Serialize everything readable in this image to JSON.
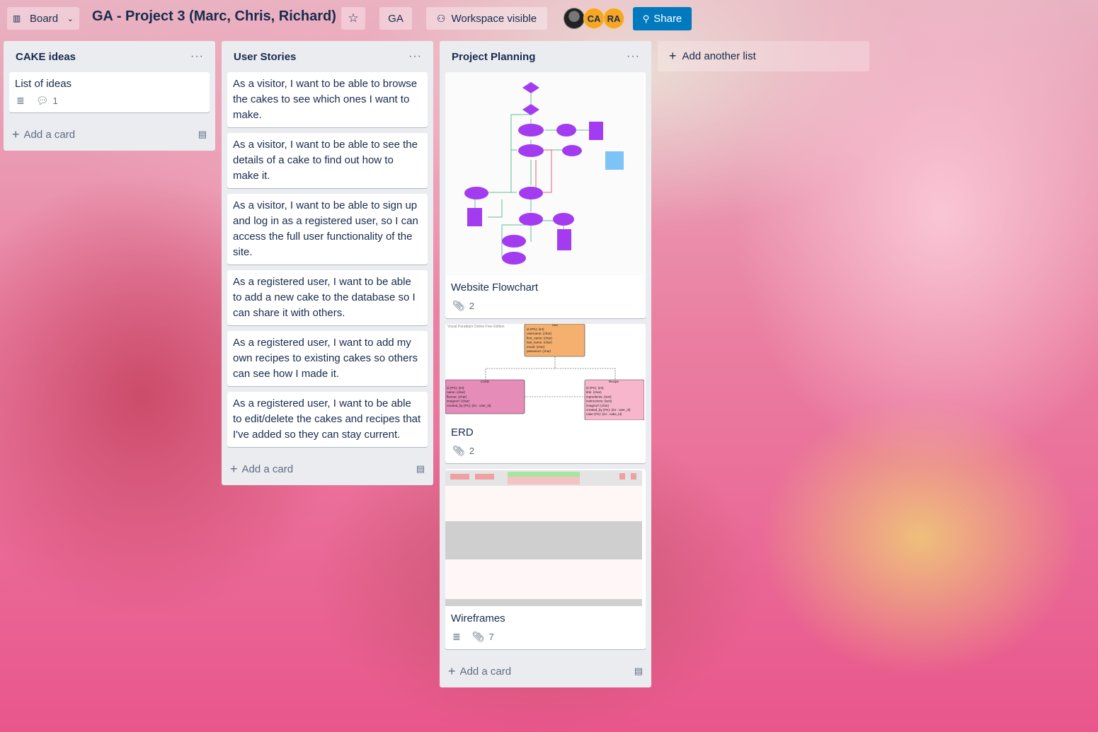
{
  "header": {
    "view_switcher": "Board",
    "board_title": "GA - Project 3 (Marc, Chris, Richard)",
    "team_label": "GA",
    "visibility_label": "Workspace visible",
    "members": [
      "CA",
      "RA"
    ],
    "share_label": "Share"
  },
  "lists": [
    {
      "title": "CAKE ideas",
      "cards": [
        {
          "text": "List of ideas",
          "comments": "1"
        }
      ],
      "add_card": "Add a card"
    },
    {
      "title": "User Stories",
      "cards": [
        {
          "text": "As a visitor, I want to be able to browse the cakes to see which ones I want to make."
        },
        {
          "text": "As a visitor, I want to be able to see the details of a cake to find out how to make it."
        },
        {
          "text": "As a visitor, I want to be able to sign up and log in as a registered user, so I can access the full user functionality of the site."
        },
        {
          "text": "As a registered user, I want to be able to add a new cake to the database so I can share it with others."
        },
        {
          "text": "As a registered user, I want to add my own recipes to existing cakes so others can see how I made it."
        },
        {
          "text": "As a registered user, I want to be able to edit/delete the cakes and recipes that I've added so they can stay current."
        }
      ],
      "add_card": "Add a card"
    },
    {
      "title": "Project Planning",
      "cards": [
        {
          "text": "Website Flowchart",
          "attachments": "2"
        },
        {
          "text": "ERD",
          "attachments": "2",
          "erd": {
            "watermark": "Visual Paradigm Online Free Edition",
            "user_table_title": "User",
            "user_fields": [
              "id (PK): (int)",
              "username: (char)",
              "first_name: (char)",
              "last_name: (char)",
              "email: (char)",
              "password: (char)"
            ],
            "cake_table_title": "CAKE",
            "cake_fields": [
              "id (PK): (int)",
              "name: (char)",
              "flavour: (char)",
              "imageurl: (char)",
              "created_by (FK): (int - user_id)"
            ],
            "recipe_table_title": "Recipe",
            "recipe_fields": [
              "id (PK): (int)",
              "title: (char)",
              "ingredients: (text)",
              "instructions: (text)",
              "imageurl: (char)",
              "created_by (FK): (int - user_id)",
              "cake (FK): (int - cake_id)"
            ]
          }
        },
        {
          "text": "Wireframes",
          "attachments": "7"
        }
      ],
      "add_card": "Add a card"
    }
  ],
  "add_list_label": "Add another list",
  "colors": {
    "list_bg": "#ebecf0",
    "share_bg": "#0079bf",
    "flowchart_purple": "#a33cf0",
    "erd_orange": "#f5b070",
    "erd_pink": "#e58cb8"
  }
}
